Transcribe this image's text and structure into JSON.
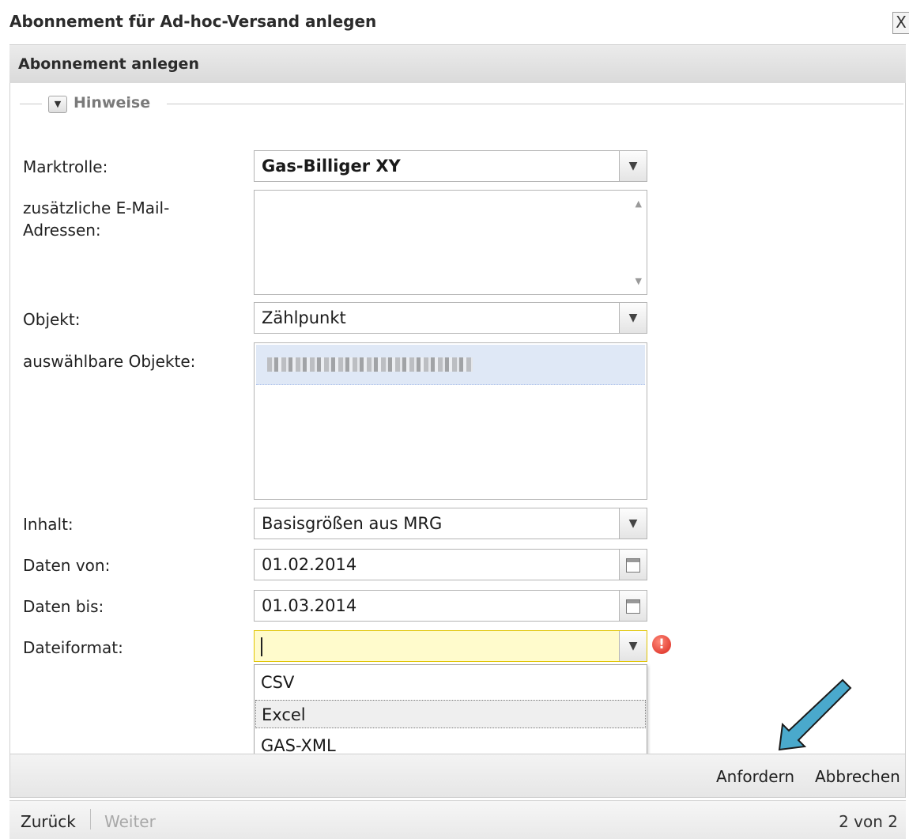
{
  "window": {
    "title": "Abonnement für Ad-hoc-Versand anlegen",
    "close_label": "X"
  },
  "panel": {
    "title": "Abonnement anlegen",
    "fieldset_legend": "Hinweise"
  },
  "form": {
    "marktrolle": {
      "label": "Marktrolle:",
      "value": "Gas-Billiger XY"
    },
    "emails": {
      "label_line1": "zusätzliche E-Mail-",
      "label_line2": "Adressen:",
      "value": ""
    },
    "objekt": {
      "label": "Objekt:",
      "value": "Zählpunkt"
    },
    "auswaehlbare": {
      "label": "auswählbare Objekte:",
      "selected_value_redacted": true
    },
    "inhalt": {
      "label": "Inhalt:",
      "value": "Basisgrößen aus MRG"
    },
    "daten_von": {
      "label": "Daten von:",
      "value": "01.02.2014"
    },
    "daten_bis": {
      "label": "Daten bis:",
      "value": "01.03.2014"
    },
    "dateiformat": {
      "label": "Dateiformat:",
      "value": "",
      "options": [
        "CSV",
        "Excel",
        "GAS-XML"
      ],
      "hovered_option": "Excel",
      "has_error": true
    }
  },
  "toolbar": {
    "request_label": "Anfordern",
    "cancel_label": "Abbrechen"
  },
  "nav": {
    "back_label": "Zurück",
    "next_label": "Weiter",
    "page_indicator": "2 von 2"
  },
  "colors": {
    "selected_row": "#dfe8f6",
    "error_field": "#fffbcc",
    "error_icon": "#d9261c",
    "annotation_arrow": "#4aa9cc"
  }
}
